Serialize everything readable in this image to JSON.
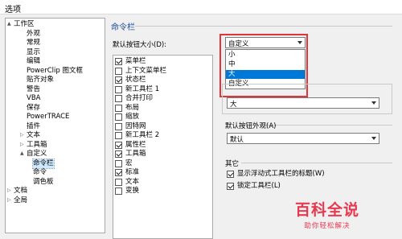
{
  "window": {
    "title": "选项"
  },
  "tree": [
    {
      "label": "工作区",
      "twisty": "▲",
      "level": 0
    },
    {
      "label": "外观",
      "level": 1
    },
    {
      "label": "常规",
      "level": 1
    },
    {
      "label": "显示",
      "level": 1
    },
    {
      "label": "编辑",
      "level": 1
    },
    {
      "label": "PowerClip 图文框",
      "level": 1
    },
    {
      "label": "贴齐对象",
      "level": 1
    },
    {
      "label": "警告",
      "level": 1
    },
    {
      "label": "VBA",
      "level": 1
    },
    {
      "label": "保存",
      "level": 1
    },
    {
      "label": "PowerTRACE",
      "level": 1
    },
    {
      "label": "插件",
      "level": 1
    },
    {
      "label": "文本",
      "twisty": "▷",
      "level": 1
    },
    {
      "label": "工具箱",
      "twisty": "▷",
      "level": 1
    },
    {
      "label": "自定义",
      "twisty": "▲",
      "level": 1
    },
    {
      "label": "命令栏",
      "level": 2,
      "selected": true
    },
    {
      "label": "命令",
      "level": 2
    },
    {
      "label": "调色板",
      "level": 2
    },
    {
      "label": "文档",
      "twisty": "▷",
      "level": 0
    },
    {
      "label": "全局",
      "twisty": "▷",
      "level": 0
    }
  ],
  "panel": {
    "section_title": "命令栏",
    "button_size_label": "默认按钮大小(D):",
    "button_size_value": "自定义",
    "size_options": [
      {
        "label": "小",
        "highlighted": false
      },
      {
        "label": "中",
        "highlighted": false
      },
      {
        "label": "大",
        "highlighted": true
      },
      {
        "label": "自定义",
        "highlighted": false
      }
    ],
    "hidden_combo_value": "大",
    "appearance_label": "默认按钮外观(A)",
    "appearance_value": "默认",
    "other_group_label": "其它",
    "checkboxes": [
      {
        "label": "显示浮动式工具栏的标题(W)",
        "checked": true
      },
      {
        "label": "锁定工具栏(L)",
        "checked": true
      }
    ]
  },
  "commandbars": [
    {
      "label": "菜单栏",
      "checked": true
    },
    {
      "label": "上下文菜单栏",
      "checked": false
    },
    {
      "label": "状态栏",
      "checked": true
    },
    {
      "label": "新工具栏 1",
      "checked": false
    },
    {
      "label": "合并打印",
      "checked": false
    },
    {
      "label": "布局",
      "checked": false
    },
    {
      "label": "缩放",
      "checked": false
    },
    {
      "label": "因特网",
      "checked": false
    },
    {
      "label": "新工具栏 2",
      "checked": false
    },
    {
      "label": "属性栏",
      "checked": true
    },
    {
      "label": "工具箱",
      "checked": true
    },
    {
      "label": "宏",
      "checked": false
    },
    {
      "label": "标准",
      "checked": true
    },
    {
      "label": "文本",
      "checked": false
    },
    {
      "label": "变换",
      "checked": false
    }
  ],
  "watermark": {
    "title": "百科全说",
    "subtitle": "助你轻松解决"
  },
  "colors": {
    "accent": "#0078d7",
    "highlight_box": "#e0353b",
    "section_title": "#1f4e9c",
    "watermark": "#e8384f"
  }
}
